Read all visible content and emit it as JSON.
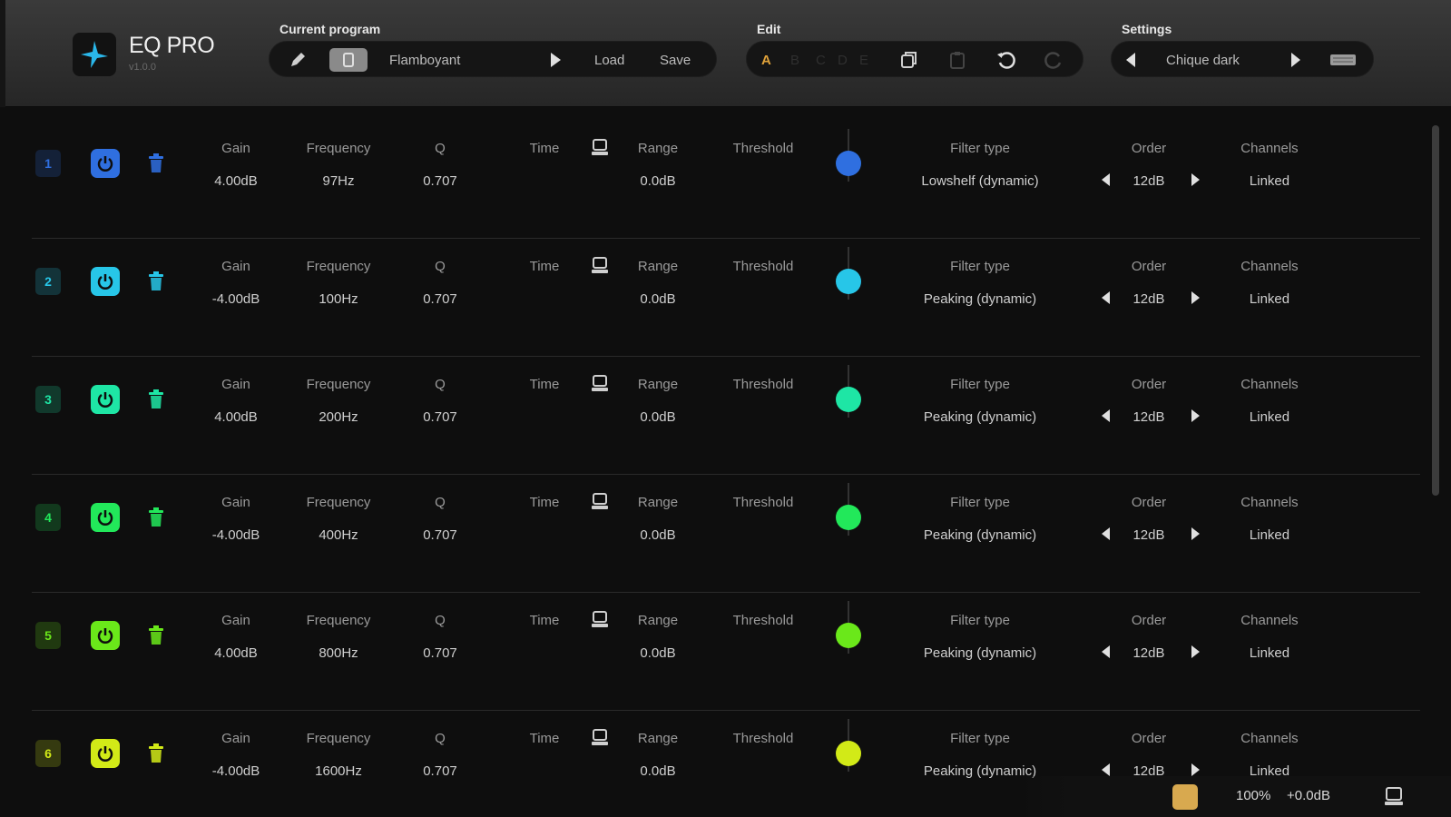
{
  "app": {
    "name": "EQ PRO",
    "version": "v1.0.0"
  },
  "toolbar": {
    "current_program_label": "Current program",
    "program_name": "Flamboyant",
    "load_label": "Load",
    "save_label": "Save",
    "edit_label": "Edit",
    "ab_slots": [
      "A",
      "B",
      "C",
      "D",
      "E"
    ],
    "settings_label": "Settings",
    "theme_name": "Chique dark"
  },
  "labels": {
    "gain": "Gain",
    "frequency": "Frequency",
    "q": "Q",
    "time": "Time",
    "range": "Range",
    "threshold": "Threshold",
    "filter_type": "Filter type",
    "order": "Order",
    "channels": "Channels"
  },
  "bands": [
    {
      "num": "1",
      "gain": "4.00dB",
      "frequency": "97Hz",
      "q": "0.707",
      "range": "0.0dB",
      "filter_type": "Lowshelf (dynamic)",
      "order": "12dB",
      "channels": "Linked",
      "color": "#2f6fe0"
    },
    {
      "num": "2",
      "gain": "-4.00dB",
      "frequency": "100Hz",
      "q": "0.707",
      "range": "0.0dB",
      "filter_type": "Peaking (dynamic)",
      "order": "12dB",
      "channels": "Linked",
      "color": "#27c6e8"
    },
    {
      "num": "3",
      "gain": "4.00dB",
      "frequency": "200Hz",
      "q": "0.707",
      "range": "0.0dB",
      "filter_type": "Peaking (dynamic)",
      "order": "12dB",
      "channels": "Linked",
      "color": "#1ee6a5"
    },
    {
      "num": "4",
      "gain": "-4.00dB",
      "frequency": "400Hz",
      "q": "0.707",
      "range": "0.0dB",
      "filter_type": "Peaking (dynamic)",
      "order": "12dB",
      "channels": "Linked",
      "color": "#22e85a"
    },
    {
      "num": "5",
      "gain": "4.00dB",
      "frequency": "800Hz",
      "q": "0.707",
      "range": "0.0dB",
      "filter_type": "Peaking (dynamic)",
      "order": "12dB",
      "channels": "Linked",
      "color": "#6ae81a"
    },
    {
      "num": "6",
      "gain": "-4.00dB",
      "frequency": "1600Hz",
      "q": "0.707",
      "range": "0.0dB",
      "filter_type": "Peaking (dynamic)",
      "order": "12dB",
      "channels": "Linked",
      "color": "#d2ea17"
    }
  ],
  "statusbar": {
    "zoom": "100%",
    "output_gain": "+0.0dB"
  },
  "colors": {
    "background": "#0e0e0e",
    "topbar": "#2f2f2f",
    "status_button": "#d8a94f"
  }
}
